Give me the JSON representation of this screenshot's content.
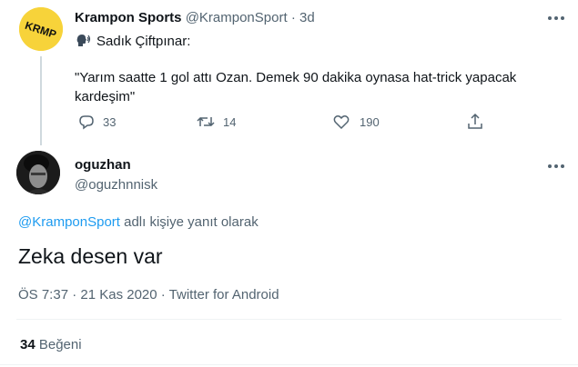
{
  "colors": {
    "link": "#1d9bf0",
    "muted": "#536471",
    "text": "#0f1419",
    "avatar_bg": "#f7d33a"
  },
  "quoted_tweet": {
    "display_name": "Krampon Sports",
    "handle": "@KramponSport",
    "separator": "·",
    "time": "3d",
    "speaker_icon": "speaking-head-icon",
    "speaker_name": "Sadık Çiftpınar:",
    "text_line1": "\"Yarım saatte 1 gol attı Ozan. Demek 90 dakika oynasa hat-trick yapacak",
    "text_line2": "kardeşim\"",
    "actions": {
      "reply_count": "33",
      "retweet_count": "14",
      "like_count": "190"
    },
    "more_icon": "more-dots-icon"
  },
  "reply_tweet": {
    "display_name": "oguzhan",
    "handle": "@oguzhnnisk",
    "reply_to_handle": "@KramponSport",
    "reply_to_suffix": "adlı kişiye yanıt olarak",
    "text": "Zeka desen var",
    "timestamp": "ÖS 7:37 · 21 Kas 2020 · Twitter for Android",
    "likes_count": "34",
    "likes_label": "Beğeni",
    "more_icon": "more-dots-icon"
  }
}
